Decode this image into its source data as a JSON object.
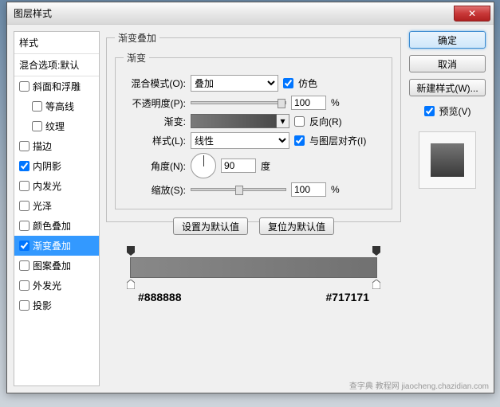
{
  "window": {
    "title": "图层样式"
  },
  "sidebar": {
    "header": "样式",
    "blend": "混合选项:默认",
    "items": [
      {
        "label": "斜面和浮雕",
        "checked": false,
        "indent": false
      },
      {
        "label": "等高线",
        "checked": false,
        "indent": true
      },
      {
        "label": "纹理",
        "checked": false,
        "indent": true
      },
      {
        "label": "描边",
        "checked": false,
        "indent": false
      },
      {
        "label": "内阴影",
        "checked": true,
        "indent": false
      },
      {
        "label": "内发光",
        "checked": false,
        "indent": false
      },
      {
        "label": "光泽",
        "checked": false,
        "indent": false
      },
      {
        "label": "颜色叠加",
        "checked": false,
        "indent": false
      },
      {
        "label": "渐变叠加",
        "checked": true,
        "indent": false,
        "selected": true
      },
      {
        "label": "图案叠加",
        "checked": false,
        "indent": false
      },
      {
        "label": "外发光",
        "checked": false,
        "indent": false
      },
      {
        "label": "投影",
        "checked": false,
        "indent": false
      }
    ]
  },
  "panel": {
    "outer_title": "渐变叠加",
    "inner_title": "渐变",
    "blend_mode_label": "混合模式(O):",
    "blend_mode_value": "叠加",
    "dither_label": "仿色",
    "opacity_label": "不透明度(P):",
    "opacity_value": "100",
    "percent": "%",
    "gradient_label": "渐变:",
    "reverse_label": "反向(R)",
    "style_label": "样式(L):",
    "style_value": "线性",
    "align_label": "与图层对齐(I)",
    "angle_label": "角度(N):",
    "angle_value": "90",
    "angle_unit": "度",
    "scale_label": "缩放(S):",
    "scale_value": "100",
    "default_btn": "设置为默认值",
    "reset_btn": "复位为默认值"
  },
  "right": {
    "ok": "确定",
    "cancel": "取消",
    "new_style": "新建样式(W)...",
    "preview": "预览(V)"
  },
  "gradient_stops": {
    "left_color": "#888888",
    "right_color": "#717171"
  },
  "watermark": "查字典 教程网  jiaocheng.chazidian.com"
}
